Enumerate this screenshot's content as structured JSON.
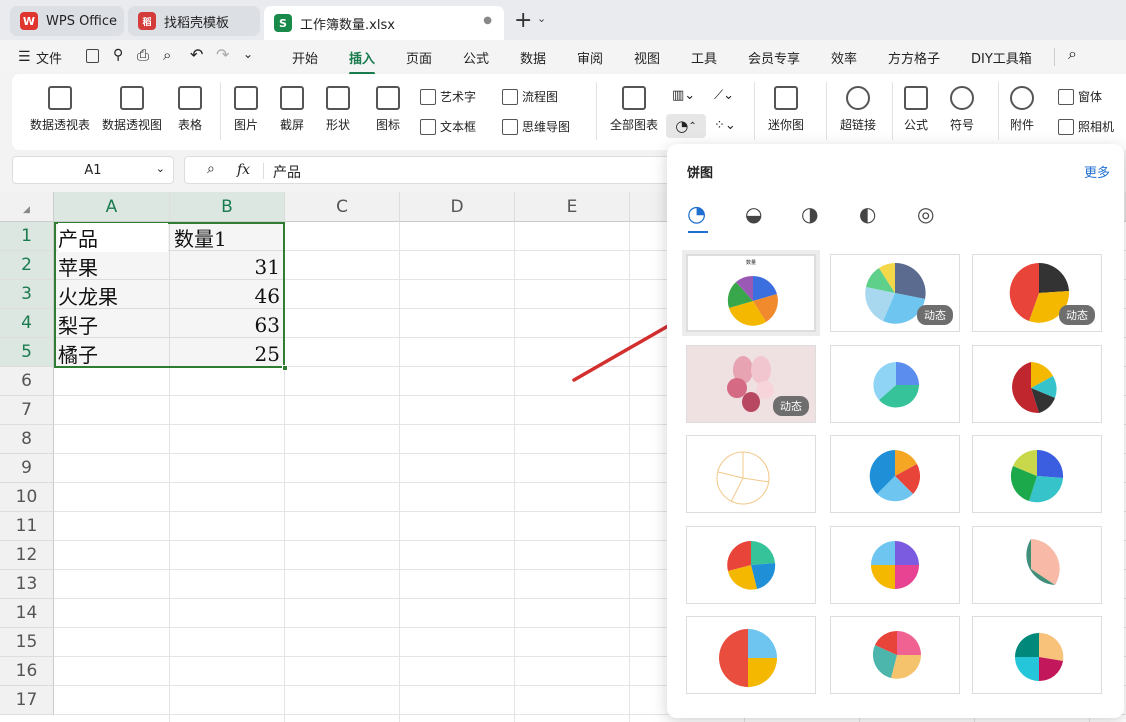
{
  "tabs": [
    {
      "label": "WPS Office",
      "logo": "W",
      "color": "#e0342f"
    },
    {
      "label": "找稻壳模板",
      "logo": "稻",
      "color": "#d43b3b"
    },
    {
      "label": "工作簿数量.xlsx",
      "logo": "S",
      "color": "#1a8a4a"
    }
  ],
  "menu": {
    "file": "文件",
    "items": [
      "开始",
      "插入",
      "页面",
      "公式",
      "数据",
      "审阅",
      "视图",
      "工具",
      "会员专享",
      "效率",
      "方方格子",
      "DIY工具箱"
    ],
    "active": "插入"
  },
  "ribbon": {
    "big": [
      "数据透视表",
      "数据透视图",
      "表格",
      "图片",
      "截屏",
      "形状",
      "图标",
      "全部图表",
      "迷你图",
      "超链接",
      "公式",
      "符号",
      "附件"
    ],
    "small": [
      "艺术字",
      "文本框",
      "流程图",
      "思维导图",
      "窗体",
      "照相机"
    ]
  },
  "formula": {
    "cell_ref": "A1",
    "fx": "fx",
    "value": "产品"
  },
  "sheet": {
    "columns": [
      "A",
      "B",
      "C",
      "D",
      "E"
    ],
    "rows": [
      "1",
      "2",
      "3",
      "4",
      "5",
      "6",
      "7",
      "8",
      "9",
      "10",
      "11",
      "12",
      "13",
      "14",
      "15",
      "16",
      "17"
    ],
    "cells": [
      [
        "产品",
        "数量1"
      ],
      [
        "苹果",
        "31"
      ],
      [
        "火龙果",
        "46"
      ],
      [
        "梨子",
        "63"
      ],
      [
        "橘子",
        "25"
      ]
    ]
  },
  "panel": {
    "title": "饼图",
    "more": "更多",
    "badge": "动态",
    "first_title": "数量"
  },
  "colors": {
    "accent": "#1a7b4f",
    "selection": "#2f7d32",
    "arrow": "#d32f2f"
  }
}
